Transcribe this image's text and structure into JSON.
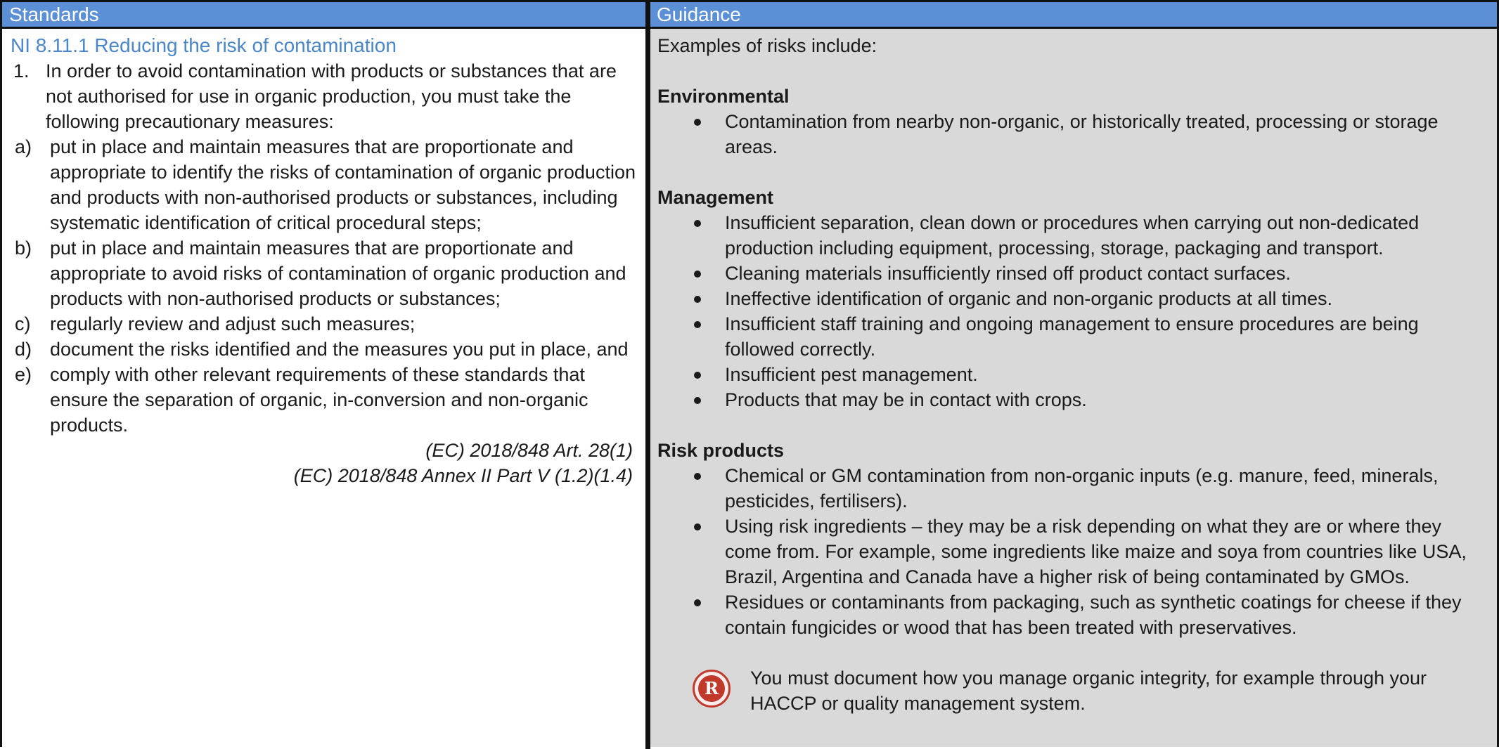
{
  "header": {
    "col1": "Standards",
    "col2": "Guidance"
  },
  "standards": {
    "title": "NI 8.11.1 Reducing the risk of contamination",
    "item1_num": "1.",
    "item1_text": "In order to avoid contamination with products or substances that are not authorised for use in organic production, you must take the following precautionary measures:",
    "sub_items": [
      {
        "letter": "a)",
        "text": "put in place and maintain measures that are proportionate and appropriate to identify the risks of contamination of organic production and products with non-authorised products or substances, including systematic identification of critical procedural steps;"
      },
      {
        "letter": "b)",
        "text": " put in place and maintain measures that are proportionate and appropriate to avoid risks of contamination of organic production and products with non-authorised products or substances;"
      },
      {
        "letter": "c)",
        "text": "regularly review and adjust such measures;"
      },
      {
        "letter": "d)",
        "text": "document the risks identified and the measures you put in place, and"
      },
      {
        "letter": "e)",
        "text": "comply with other relevant requirements of these standards that ensure the separation of organic, in-conversion and non-organic products."
      }
    ],
    "refs": [
      "(EC) 2018/848 Art. 28(1)",
      "(EC) 2018/848 Annex II Part V (1.2)(1.4)"
    ]
  },
  "guidance": {
    "intro": "Examples of risks include:",
    "sections": [
      {
        "heading": "Environmental",
        "bullets": [
          "Contamination from nearby non-organic, or historically treated, processing or storage areas."
        ]
      },
      {
        "heading": "Management",
        "bullets": [
          "Insufficient separation, clean down or procedures when carrying out non-dedicated production including equipment, processing, storage, packaging and transport.",
          "Cleaning materials insufficiently rinsed off product contact surfaces.",
          "Ineffective identification of organic and non-organic products at all times.",
          "Insufficient staff training and ongoing management to ensure procedures are being followed correctly.",
          "Insufficient pest management.",
          "Products that may be in contact with crops."
        ]
      },
      {
        "heading": "Risk products",
        "bullets": [
          "Chemical or GM contamination from non-organic inputs (e.g. manure, feed, minerals, pesticides, fertilisers).",
          "Using risk ingredients – they may be a risk depending on what they are or where they come from. For example, some ingredients like maize and soya from countries like USA, Brazil, Argentina and Canada have a higher risk of being contaminated by GMOs.",
          "Residues or contaminants from packaging, such as synthetic coatings for cheese if they contain fungicides or wood that has been treated with preservatives."
        ]
      }
    ],
    "note": {
      "icon": "R",
      "text": "You must document how you manage organic integrity, for example through your HACCP or quality management system."
    }
  },
  "colors": {
    "header_bg": "#5b8fd6",
    "title_blue": "#4a86c8",
    "guidance_bg": "#d9d9d9",
    "icon_red": "#c0392b"
  }
}
